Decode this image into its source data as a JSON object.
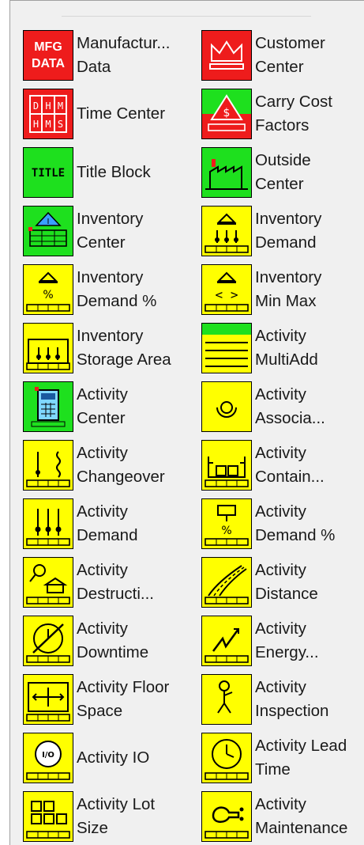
{
  "colors": {
    "red": "#ee1c1c",
    "green": "#1ee01e",
    "yellow": "#ffff00"
  },
  "items": [
    {
      "name": "manufacturing-data",
      "icon": "mfg-data-icon",
      "color": "red",
      "lines": [
        "Manufactur...",
        "Data"
      ],
      "glyph": "MFG DATA"
    },
    {
      "name": "customer-center",
      "icon": "crown-icon",
      "color": "red",
      "lines": [
        "Customer",
        "Center"
      ]
    },
    {
      "name": "time-center",
      "icon": "dhm-clock-icon",
      "color": "red",
      "lines": [
        "Time Center"
      ],
      "glyph": "DHM HMS"
    },
    {
      "name": "carry-cost-factors",
      "icon": "dollar-triangle-icon",
      "color": "green-red",
      "lines": [
        "Carry Cost",
        "Factors"
      ]
    },
    {
      "name": "title-block",
      "icon": "title-block-icon",
      "color": "green",
      "lines": [
        "Title Block"
      ],
      "glyph": "TITLE"
    },
    {
      "name": "outside-center",
      "icon": "factory-icon",
      "color": "green",
      "lines": [
        "Outside",
        "Center"
      ]
    },
    {
      "name": "inventory-center",
      "icon": "inventory-center-icon",
      "color": "green",
      "lines": [
        "Inventory",
        "Center"
      ]
    },
    {
      "name": "inventory-demand",
      "icon": "inventory-demand-icon",
      "color": "yellow",
      "lines": [
        "Inventory",
        "Demand"
      ]
    },
    {
      "name": "inventory-demand-pct",
      "icon": "inventory-demand-percent-icon",
      "color": "yellow",
      "lines": [
        "Inventory",
        "Demand %"
      ],
      "glyph": "%"
    },
    {
      "name": "inventory-min-max",
      "icon": "inventory-min-max-icon",
      "color": "yellow",
      "lines": [
        "Inventory",
        "Min Max"
      ]
    },
    {
      "name": "inventory-storage-area",
      "icon": "storage-area-icon",
      "color": "yellow",
      "lines": [
        "Inventory",
        "Storage Area"
      ]
    },
    {
      "name": "activity-multiadd",
      "icon": "multiadd-icon",
      "color": "green-yellow",
      "lines": [
        "Activity",
        "MultiAdd"
      ]
    },
    {
      "name": "activity-center",
      "icon": "calculator-icon",
      "color": "green",
      "lines": [
        "Activity",
        "Center"
      ]
    },
    {
      "name": "activity-associations",
      "icon": "association-icon",
      "color": "yellow",
      "lines": [
        "Activity",
        "Associa..."
      ]
    },
    {
      "name": "activity-changeover",
      "icon": "changeover-icon",
      "color": "yellow",
      "lines": [
        "Activity",
        "Changeover"
      ]
    },
    {
      "name": "activity-container",
      "icon": "container-icon",
      "color": "yellow",
      "lines": [
        "Activity",
        "Contain..."
      ]
    },
    {
      "name": "activity-demand",
      "icon": "activity-demand-icon",
      "color": "yellow",
      "lines": [
        "Activity",
        "Demand"
      ]
    },
    {
      "name": "activity-demand-pct",
      "icon": "activity-demand-percent-icon",
      "color": "yellow",
      "lines": [
        "Activity",
        "Demand %"
      ],
      "glyph": "%"
    },
    {
      "name": "activity-destruction",
      "icon": "destruction-icon",
      "color": "yellow",
      "lines": [
        "Activity",
        "Destructi..."
      ]
    },
    {
      "name": "activity-distance",
      "icon": "road-icon",
      "color": "yellow",
      "lines": [
        "Activity",
        "Distance"
      ]
    },
    {
      "name": "activity-downtime",
      "icon": "downtime-icon",
      "color": "yellow",
      "lines": [
        "Activity",
        "Downtime"
      ]
    },
    {
      "name": "activity-energy",
      "icon": "energy-icon",
      "color": "yellow",
      "lines": [
        "Activity",
        "Energy..."
      ]
    },
    {
      "name": "activity-floor-space",
      "icon": "floor-space-icon",
      "color": "yellow",
      "lines": [
        "Activity Floor",
        "Space"
      ]
    },
    {
      "name": "activity-inspection",
      "icon": "inspection-icon",
      "color": "yellow",
      "lines": [
        "Activity",
        "Inspection"
      ]
    },
    {
      "name": "activity-io",
      "icon": "recycle-io-icon",
      "color": "yellow",
      "lines": [
        "Activity IO"
      ],
      "glyph": "I/O"
    },
    {
      "name": "activity-lead-time",
      "icon": "lead-time-clock-icon",
      "color": "yellow",
      "lines": [
        "Activity Lead",
        "Time"
      ]
    },
    {
      "name": "activity-lot-size",
      "icon": "lot-size-icon",
      "color": "yellow",
      "lines": [
        "Activity Lot",
        "Size"
      ]
    },
    {
      "name": "activity-maintenance",
      "icon": "maintenance-icon",
      "color": "yellow",
      "lines": [
        "Activity",
        "Maintenance"
      ]
    }
  ]
}
